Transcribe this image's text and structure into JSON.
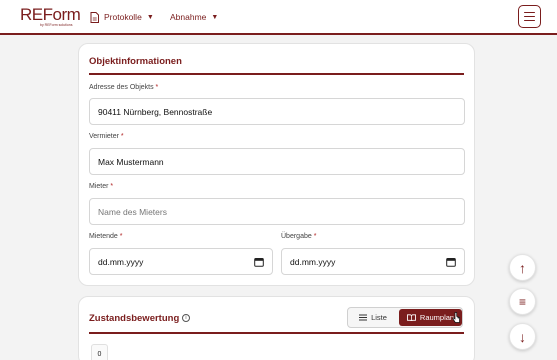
{
  "header": {
    "logo": "REForm",
    "logo_sub": "by REForm solutions",
    "nav": [
      {
        "label": "Protokolle",
        "icon": "document-icon"
      },
      {
        "label": "Abnahme"
      }
    ],
    "menu_icon": "hamburger-icon"
  },
  "objekt": {
    "title": "Objektinformationen",
    "adresse": {
      "label": "Adresse des Objekts",
      "value": "90411 Nürnberg, Bennostraße"
    },
    "vermieter": {
      "label": "Vermieter",
      "value": "Max Mustermann"
    },
    "mieter": {
      "label": "Mieter",
      "placeholder": "Name des Mieters"
    },
    "mietende": {
      "label": "Mietende",
      "value": "dd.mm.yyyy"
    },
    "uebergabe": {
      "label": "Übergabe",
      "value": "dd.mm.yyyy"
    },
    "required_mark": "*"
  },
  "zustand": {
    "title": "Zustandsbewertung",
    "info_icon": "i",
    "toggle": {
      "liste": "Liste",
      "raumplan": "Raumplan",
      "selected": "Raumplan"
    },
    "chip": "0"
  },
  "fabs": {
    "up": "↑",
    "menu": "≡",
    "down": "↓"
  },
  "colors": {
    "accent": "#7a1d1d",
    "background": "#f3f3f3"
  }
}
